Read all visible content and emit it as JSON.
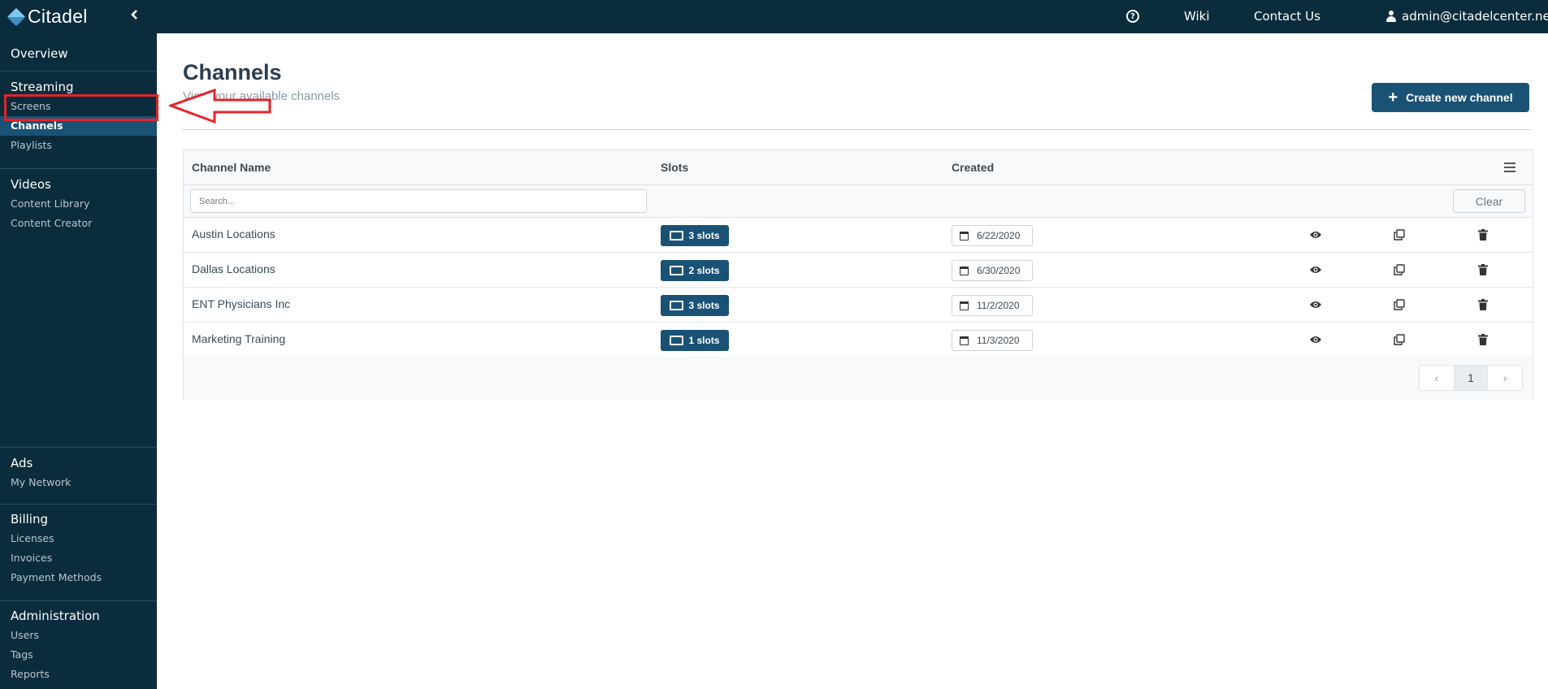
{
  "app": {
    "name": "Citadel"
  },
  "topnav": {
    "wiki": "Wiki",
    "contact": "Contact Us",
    "user_email": "admin@citadelcenter.net"
  },
  "sidebar": {
    "overview": "Overview",
    "streaming": {
      "title": "Streaming",
      "items": [
        "Screens",
        "Channels",
        "Playlists"
      ],
      "active": "Channels"
    },
    "videos": {
      "title": "Videos",
      "items": [
        "Content Library",
        "Content Creator"
      ]
    },
    "ads": {
      "title": "Ads",
      "items": [
        "My Network"
      ]
    },
    "billing": {
      "title": "Billing",
      "items": [
        "Licenses",
        "Invoices",
        "Payment Methods"
      ]
    },
    "administration": {
      "title": "Administration",
      "items": [
        "Users",
        "Tags",
        "Reports"
      ]
    }
  },
  "page": {
    "title": "Channels",
    "subtitle": "View your available channels",
    "create_button": "Create new channel"
  },
  "table": {
    "columns": [
      "Channel Name",
      "Slots",
      "Created"
    ],
    "search_placeholder": "Search...",
    "clear_label": "Clear",
    "rows": [
      {
        "name": "Austin Locations",
        "slots": "3 slots",
        "created": "6/22/2020"
      },
      {
        "name": "Dallas Locations",
        "slots": "2 slots",
        "created": "6/30/2020"
      },
      {
        "name": "ENT Physicians Inc",
        "slots": "3 slots",
        "created": "11/2/2020"
      },
      {
        "name": "Marketing Training",
        "slots": "1 slots",
        "created": "11/3/2020"
      }
    ],
    "pagination": {
      "current_page": "1",
      "prev": "‹",
      "next": "›"
    }
  },
  "icons": {
    "help": "question-circle-icon",
    "user": "user-icon",
    "view": "eye-icon",
    "copy": "copy-icon",
    "delete": "trash-icon",
    "slots": "monitor-icon",
    "date": "calendar-icon"
  },
  "colors": {
    "nav_bg": "#0b2c3d",
    "accent": "#1a5276",
    "annotation": "#e3242b"
  }
}
